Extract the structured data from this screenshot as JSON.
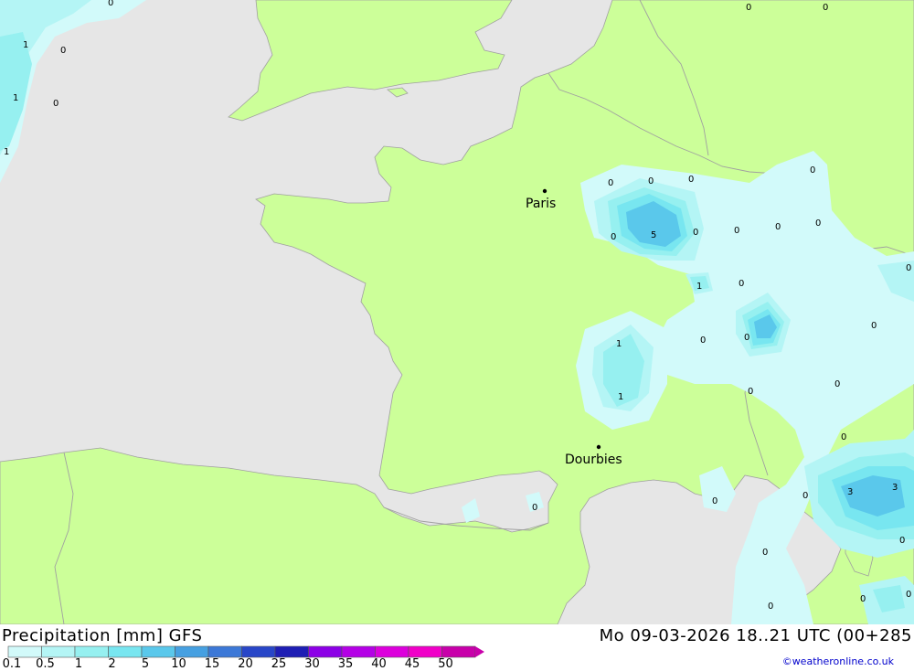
{
  "header": {
    "title_left": "Precipitation [mm] GFS",
    "title_right": "Mo 09-03-2026 18..21 UTC (00+285",
    "credit": "©weatheronline.co.uk"
  },
  "legend": {
    "labels": [
      "0.1",
      "0.5",
      "1",
      "2",
      "5",
      "10",
      "15",
      "20",
      "25",
      "30",
      "35",
      "40",
      "45",
      "50"
    ],
    "colors": [
      "#d2fafa",
      "#b4f5f5",
      "#96f0f0",
      "#78e6f0",
      "#5ac8eb",
      "#46a0e1",
      "#3c78d7",
      "#2846c8",
      "#1e1eb4",
      "#8c00e6",
      "#b400e6",
      "#dc00dc",
      "#f000c8",
      "#c800aa"
    ]
  },
  "map": {
    "colors": {
      "sea": "#e6e6e6",
      "land": "#ccff99",
      "border": "#a0a0a0"
    },
    "cities": [
      {
        "name": "Paris"
      },
      {
        "name": "Dourbies"
      }
    ],
    "values": [
      "0",
      "1",
      "0",
      "1",
      "0",
      "1",
      "0",
      "0",
      "0",
      "0",
      "0",
      "0",
      "5",
      "0",
      "0",
      "1",
      "0",
      "0",
      "0",
      "0",
      "0",
      "0",
      "1",
      "1",
      "0",
      "0",
      "0",
      "0",
      "0",
      "0",
      "3",
      "3",
      "0",
      "0",
      "0",
      "0",
      "0",
      "0",
      "0"
    ]
  }
}
